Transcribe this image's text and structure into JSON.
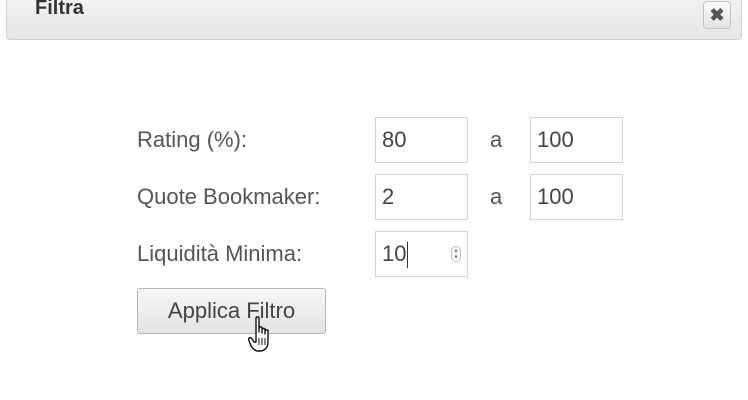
{
  "dialog": {
    "title": "Filtra",
    "close_icon": "close-icon"
  },
  "form": {
    "rating": {
      "label": "Rating (%):",
      "from": "80",
      "separator": "a",
      "to": "100"
    },
    "odds": {
      "label": "Quote Bookmaker:",
      "from": "2",
      "separator": "a",
      "to": "100"
    },
    "liquidity": {
      "label": "Liquidità Minima:",
      "value": "10"
    },
    "apply_label": "Applica Filtro"
  }
}
